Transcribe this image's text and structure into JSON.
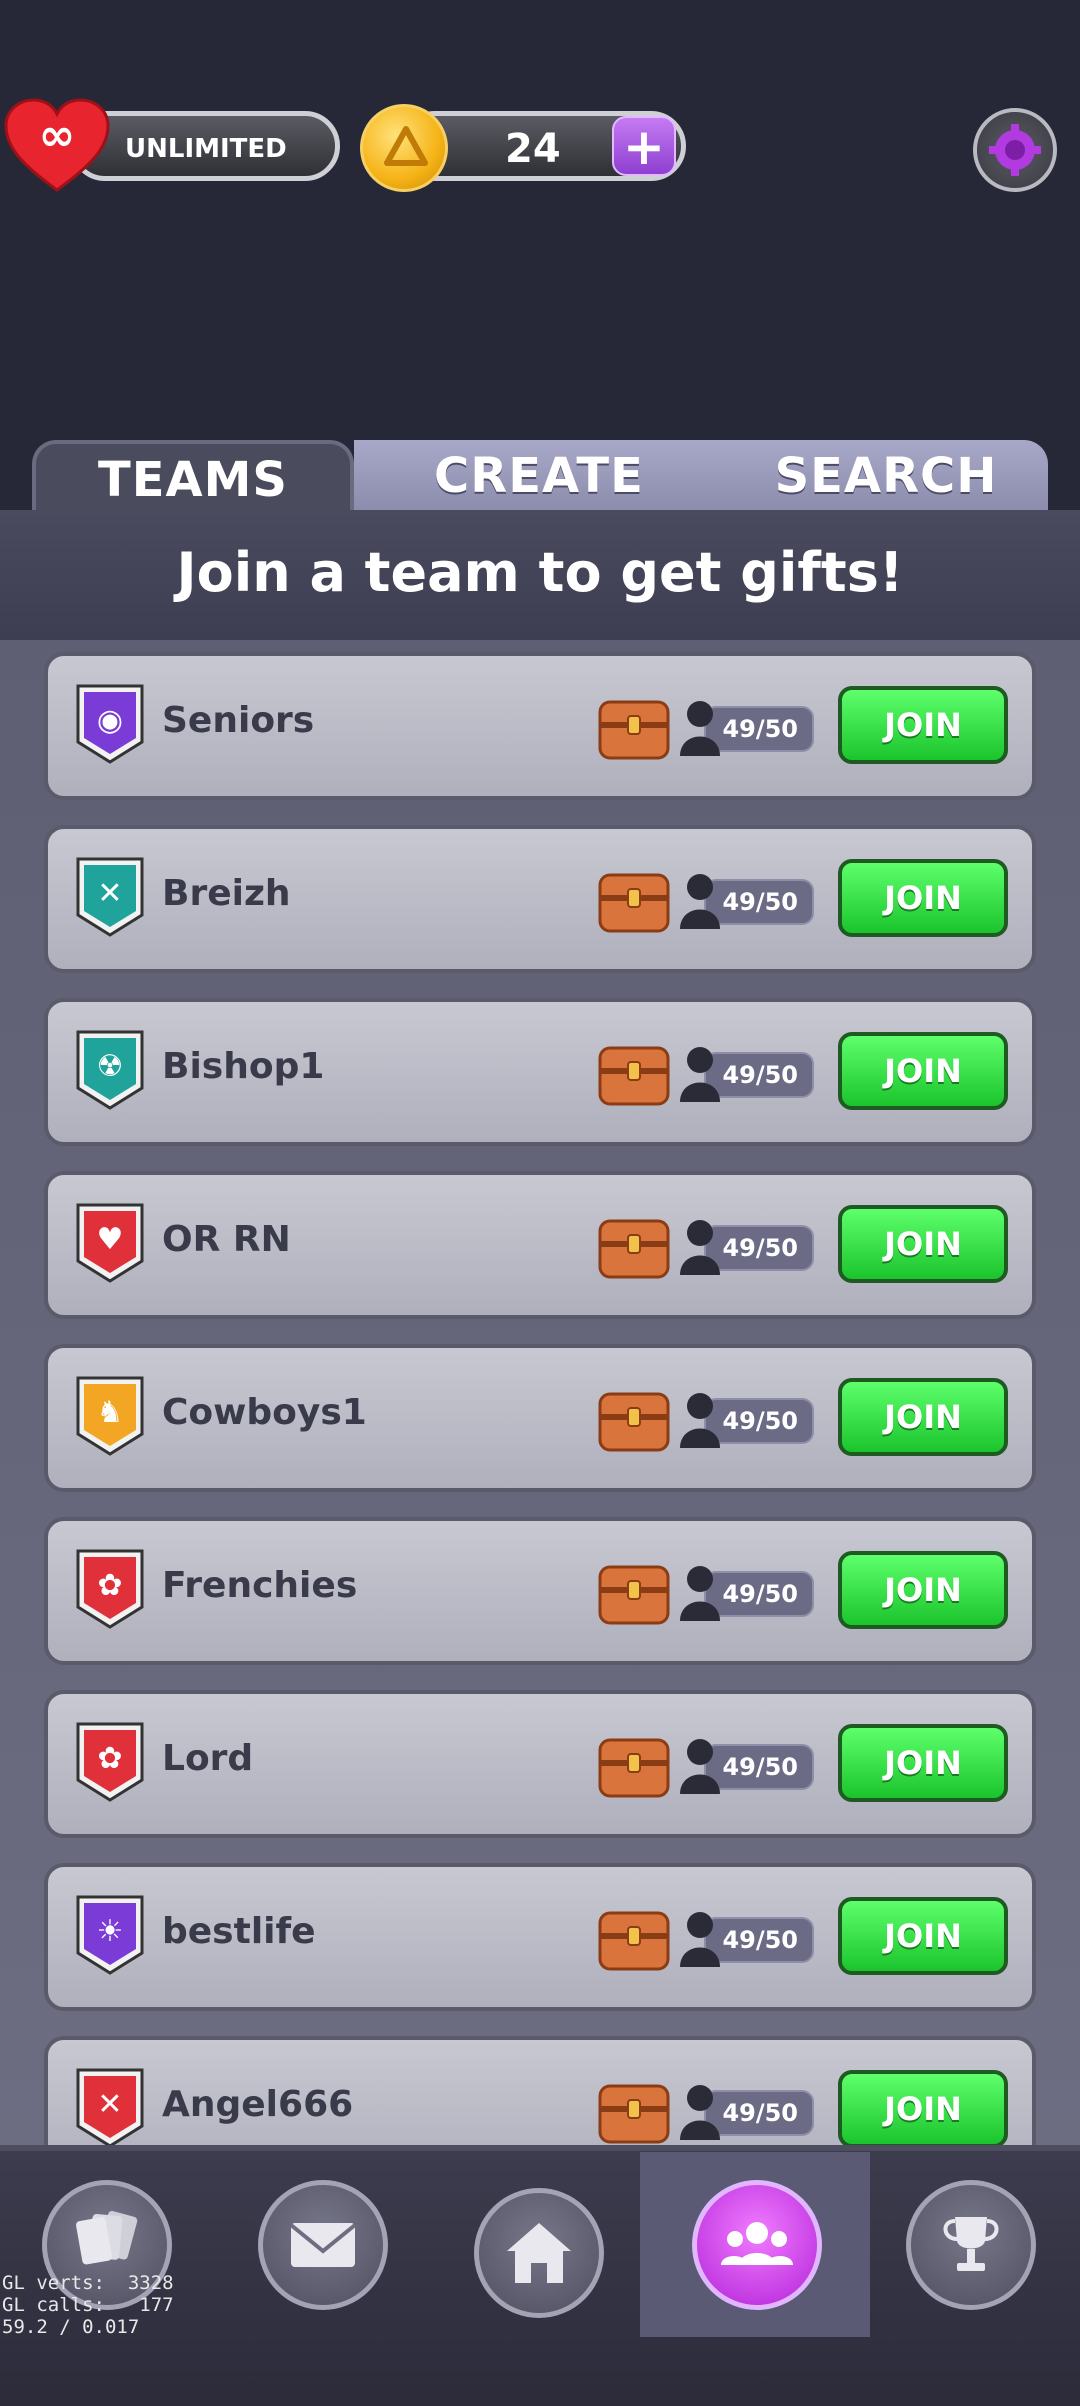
{
  "status": {
    "lives_label": "UNLIMITED",
    "coins": "24",
    "plus_label": "+"
  },
  "tabs": [
    {
      "label": "TEAMS"
    },
    {
      "label": "CREATE"
    },
    {
      "label": "SEARCH"
    }
  ],
  "banner": "Join a team to get gifts!",
  "teams": [
    {
      "name": "Seniors",
      "members": "49/50",
      "join": "JOIN",
      "emblem": "owl-icon",
      "color": "#7a3bd6"
    },
    {
      "name": "Breizh",
      "members": "49/50",
      "join": "JOIN",
      "emblem": "crossed-swords-icon",
      "color": "#1fa39a"
    },
    {
      "name": "Bishop1",
      "members": "49/50",
      "join": "JOIN",
      "emblem": "radiation-icon",
      "color": "#1fa39a"
    },
    {
      "name": "OR RN",
      "members": "49/50",
      "join": "JOIN",
      "emblem": "heart-icon",
      "color": "#e0313b"
    },
    {
      "name": "Cowboys1",
      "members": "49/50",
      "join": "JOIN",
      "emblem": "lion-icon",
      "color": "#f2a623"
    },
    {
      "name": "Frenchies",
      "members": "49/50",
      "join": "JOIN",
      "emblem": "paw-icon",
      "color": "#e0313b"
    },
    {
      "name": "Lord",
      "members": "49/50",
      "join": "JOIN",
      "emblem": "paw-icon",
      "color": "#e0313b"
    },
    {
      "name": "bestlife",
      "members": "49/50",
      "join": "JOIN",
      "emblem": "sun-icon",
      "color": "#7a3bd6"
    },
    {
      "name": "Angel666",
      "members": "49/50",
      "join": "JOIN",
      "emblem": "crossed-swords-icon",
      "color": "#e0313b"
    }
  ],
  "nav": [
    {
      "name": "cards-icon"
    },
    {
      "name": "mail-icon"
    },
    {
      "name": "home-icon"
    },
    {
      "name": "team-icon"
    },
    {
      "name": "trophy-icon"
    }
  ],
  "debug": "GL verts:  3328\nGL calls:   177\n59.2 / 0.017"
}
